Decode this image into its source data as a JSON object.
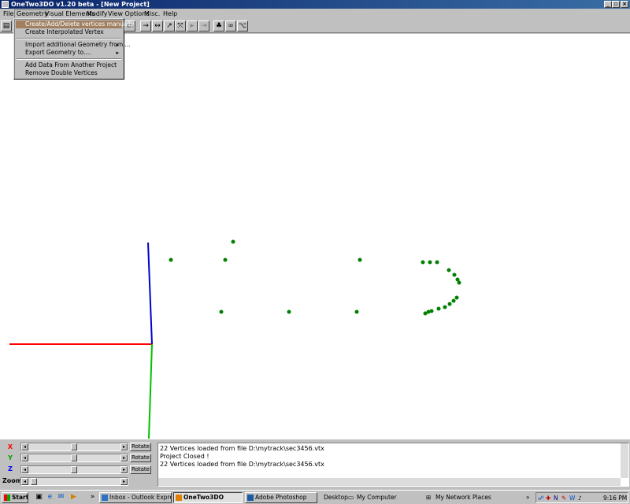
{
  "window": {
    "title": "OneTwo3DO  v1.20 beta - [New Project]"
  },
  "menubar": {
    "items": [
      {
        "label": "File"
      },
      {
        "label": "Geometry"
      },
      {
        "label": "Visual Elements"
      },
      {
        "label": "Modify"
      },
      {
        "label": "View Options"
      },
      {
        "label": "Misc."
      },
      {
        "label": "Help"
      }
    ]
  },
  "geometry_menu": {
    "items": [
      {
        "label": "Create/Add/Delete vertices manually"
      },
      {
        "label": "Create Interpolated Vertex"
      },
      {
        "label": "Import additional Geometry from...."
      },
      {
        "label": "Export Geometry to...."
      },
      {
        "label": "Add Data From Another Project"
      },
      {
        "label": "Remove Double Vertices"
      }
    ]
  },
  "controls": {
    "x_label": "X",
    "y_label": "Y",
    "z_label": "Z",
    "zoom_label": "Zoom",
    "rotate_label": "Rotate",
    "x_color": "#ff0000",
    "y_color": "#00a000",
    "z_color": "#0000ff"
  },
  "log": {
    "lines": [
      "22 Vertices loaded from file D:\\mytrack\\sec3456.vtx",
      "Project Closed !",
      "22 Vertices loaded from file D:\\mytrack\\sec3456.vtx"
    ]
  },
  "taskbar": {
    "start_label": "Start",
    "tasks": [
      {
        "label": "Inbox - Outlook Express"
      },
      {
        "label": "OneTwo3DO"
      },
      {
        "label": "Adobe Photoshop"
      }
    ],
    "desktop_label": "Desktop",
    "my_computer_label": "My Computer",
    "network_label": "My Network Places",
    "clock": "9:16 PM"
  },
  "viewport": {
    "axis_colors": {
      "x": "#ff0000",
      "y": "#00c000",
      "z": "#0000cc"
    },
    "vertex_color": "#008000",
    "vertex_count": 22
  }
}
